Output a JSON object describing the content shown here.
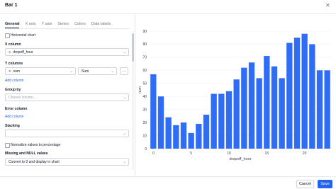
{
  "dialog": {
    "title": "Bar 1"
  },
  "tabs": [
    {
      "label": "General"
    },
    {
      "label": "X axis"
    },
    {
      "label": "Y axis"
    },
    {
      "label": "Series"
    },
    {
      "label": "Colors"
    },
    {
      "label": "Data labels"
    }
  ],
  "general": {
    "horizontal_chart": "Horizontal chart",
    "x_column_label": "X column",
    "x_column_value": "dropoff_hour",
    "y_columns_label": "Y columns",
    "y_column_value": "num",
    "y_agg_value": "Sum",
    "y_more": "⋯",
    "add_column": "Add column",
    "group_by_label": "Group by",
    "group_by_placeholder": "Choose column...",
    "error_column_label": "Error column",
    "add_error_column": "Add column",
    "stacking_label": "Stacking",
    "stacking_value": "",
    "normalize_label": "Normalize values to percentage",
    "missing_label": "Missing and NULL values",
    "missing_value": "Convert to 0 and display in chart"
  },
  "footer": {
    "cancel": "Cancel",
    "save": "Save"
  },
  "colors": {
    "bar": "#2f6df6",
    "primary": "#2563eb"
  },
  "chart_data": {
    "type": "bar",
    "x": [
      0,
      1,
      2,
      3,
      4,
      5,
      6,
      7,
      8,
      9,
      10,
      11,
      12,
      13,
      14,
      15,
      16,
      17,
      18,
      19,
      20,
      21,
      22,
      23
    ],
    "values": [
      57,
      40,
      24,
      18,
      20,
      12,
      19,
      26,
      42,
      42,
      44,
      53,
      62,
      66,
      54,
      71,
      63,
      54,
      81,
      85,
      88,
      80,
      60,
      60
    ],
    "xticks": [
      0,
      5,
      10,
      15,
      20
    ],
    "yticks": [
      0,
      10,
      20,
      30,
      40,
      50,
      60,
      70,
      80,
      90
    ],
    "xlabel": "dropoff_hour",
    "ylabel": "num",
    "ylim": [
      0,
      90
    ]
  }
}
